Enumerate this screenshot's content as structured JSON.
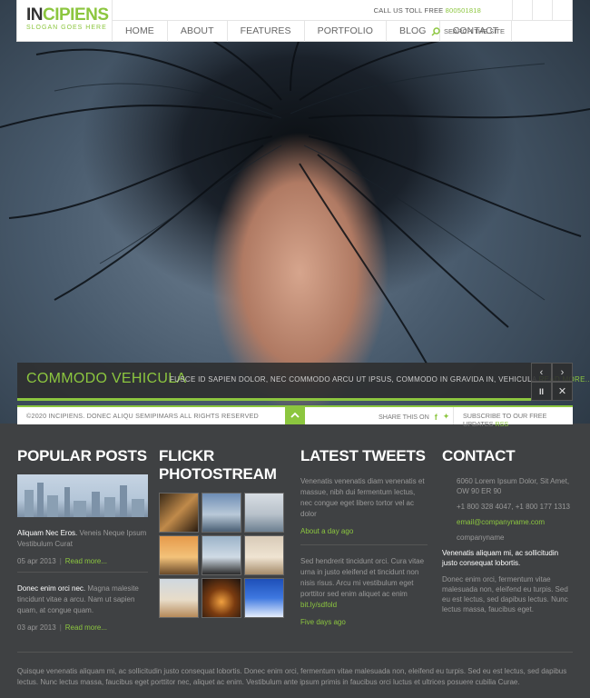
{
  "header": {
    "logo_main": "IN",
    "logo_accent": "CIPIENS",
    "slogan": "SLOGAN GOES HERE",
    "call_label": "CALL US TOLL FREE",
    "call_number": "800501818",
    "nav": [
      "HOME",
      "ABOUT",
      "FEATURES",
      "PORTFOLIO",
      "BLOG",
      "CONTACT"
    ],
    "search_label": "SEARCH THE SITE"
  },
  "slider": {
    "caption_title": "COMMODO VEHICULA",
    "caption_text": "FUSCE ID SAPIEN DOLOR, NEC COMMODO ARCU UT IPSUS, COMMODO IN GRAVIDA IN, VEHICULA",
    "read_more": "READ MORE..."
  },
  "strip": {
    "copyright": "©2020 INCIPIENS. DONEC ALIQU SEMIPIMARS ALL RIGHTS RESERVED",
    "share_label": "SHARE THIS ON",
    "subscribe_label": "SUBSCRIBE TO OUR FREE UPDATES",
    "rss": "RSS"
  },
  "footer": {
    "popular": {
      "title": "POPULAR POSTS",
      "posts": [
        {
          "title": "Aliquam Nec Eros.",
          "text": "Veneis Neque Ipsum Vestibulum Curat",
          "date": "05 apr 2013",
          "more": "Read more..."
        },
        {
          "title": "Donec enim orci nec.",
          "text": "Magna malesite tincidunt vitae a arcu. Nam ut sapien quam, at congue quam.",
          "date": "03 apr 2013",
          "more": "Read more..."
        }
      ]
    },
    "flickr": {
      "title": "FLICKR PHOTOSTREAM"
    },
    "tweets": {
      "title": "LATEST TWEETS",
      "items": [
        {
          "text": "Venenatis venenatis diam venenatis et massue, nibh dui fermentum lectus, nec congue eget libero tortor vel ac dolor",
          "link": "",
          "time": "About a day ago"
        },
        {
          "text": "Sed hendrerit tincidunt orci. Cura vitae urna in justo eleifend et tincidunt non nisis risus. Arcu mi vestibulum eget porttitor sed enim aliquet ac enim",
          "link": "bit.ly/sdfold",
          "time": "Five days ago"
        }
      ]
    },
    "contact": {
      "title": "CONTACT",
      "address": "6060 Lorem Ipsum Dolor, Sit Amet, OW 90 ER 90",
      "phones": "+1 800 328 4047, +1 800 177 1313",
      "email": "email@companyname.com",
      "company": "companyname",
      "strong": "Venenatis aliquam mi, ac sollicitudin justo consequat lobortis.",
      "text": "Donec enim orci, fermentum vitae malesuada non, eleifend eu turpis. Sed eu est lectus, sed dapibus lectus. Nunc lectus massa, faucibus eget."
    },
    "bottom": "Quisque venenatis aliquam mi, ac sollicitudin justo consequat lobortis. Donec enim orci, fermentum vitae malesuada non, eleifend eu turpis. Sed eu est lectus, sed dapibus lectus. Nunc lectus massa, faucibus eget porttitor nec, aliquet ac enim. Vestibulum ante ipsum primis in faucibus orci luctus et ultrices posuere cubilia Curae."
  },
  "colors": {
    "accent": "#8cc63f",
    "footer_bg": "#3f4143"
  },
  "icons": [
    "search-icon",
    "arrow-left-icon",
    "arrow-right-icon",
    "pause-icon",
    "close-icon",
    "arrow-up-icon",
    "facebook-icon",
    "twitter-icon"
  ]
}
